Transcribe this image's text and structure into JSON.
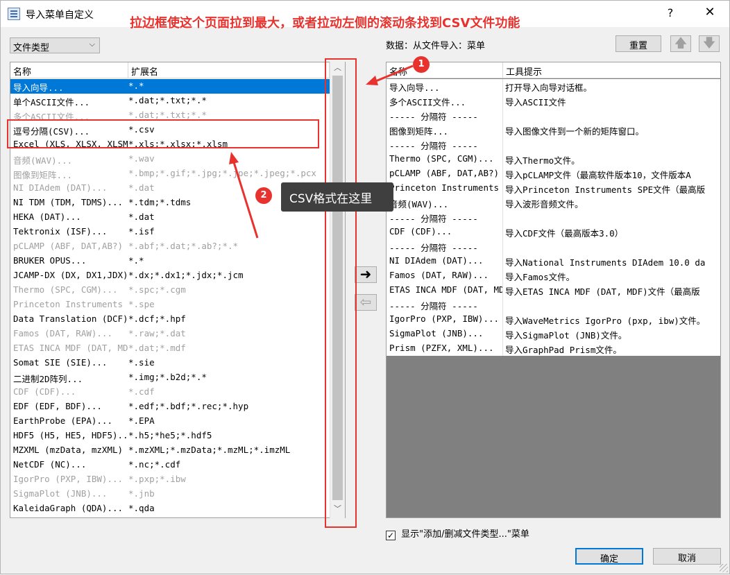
{
  "window": {
    "title": "导入菜单自定义",
    "help": "?",
    "close": "✕"
  },
  "annotation_top": "拉边框使这个页面拉到最大，或者拉动左侧的滚动条找到CSV文件功能",
  "filetype_select": {
    "value": "文件类型",
    "chevron": "⌵"
  },
  "left_list": {
    "headers": [
      "名称",
      "扩展名"
    ],
    "rows": [
      {
        "name": "导入向导...",
        "ext": "*.*",
        "state": "selected"
      },
      {
        "name": "单个ASCII文件...",
        "ext": "*.dat;*.txt;*.*",
        "state": "normal"
      },
      {
        "name": "多个ASCII文件...",
        "ext": "*.dat;*.txt;*.*",
        "state": "disabled"
      },
      {
        "name": "逗号分隔(CSV)...",
        "ext": "*.csv",
        "state": "normal"
      },
      {
        "name": "Excel (XLS, XLSX, XLSM)",
        "ext": "*.xls;*.xlsx;*.xlsm",
        "state": "normal"
      },
      {
        "name": "音频(WAV)...",
        "ext": "*.wav",
        "state": "disabled"
      },
      {
        "name": "图像到矩阵...",
        "ext": "*.bmp;*.gif;*.jpg;*.jpe;*.jpeg;*.pcx",
        "state": "disabled"
      },
      {
        "name": "NI DIAdem (DAT)...",
        "ext": "*.dat",
        "state": "disabled"
      },
      {
        "name": "NI TDM (TDM, TDMS)...",
        "ext": "*.tdm;*.tdms",
        "state": "normal"
      },
      {
        "name": "HEKA (DAT)...",
        "ext": "*.dat",
        "state": "normal"
      },
      {
        "name": "Tektronix (ISF)...",
        "ext": "*.isf",
        "state": "normal"
      },
      {
        "name": "pCLAMP (ABF, DAT,AB?)",
        "ext": "*.abf;*.dat;*.ab?;*.*",
        "state": "disabled"
      },
      {
        "name": "BRUKER OPUS...",
        "ext": "*.*",
        "state": "normal"
      },
      {
        "name": "JCAMP-DX (DX, DX1,JDX)",
        "ext": "*.dx;*.dx1;*.jdx;*.jcm",
        "state": "normal"
      },
      {
        "name": "Thermo (SPC, CGM)...",
        "ext": "*.spc;*.cgm",
        "state": "disabled"
      },
      {
        "name": "Princeton Instruments",
        "ext": "*.spe",
        "state": "disabled"
      },
      {
        "name": "Data Translation (DCF)",
        "ext": "*.dcf;*.hpf",
        "state": "normal"
      },
      {
        "name": "Famos (DAT, RAW)...",
        "ext": "*.raw;*.dat",
        "state": "disabled"
      },
      {
        "name": "ETAS INCA MDF (DAT, MDF)",
        "ext": "*.dat;*.mdf",
        "state": "disabled"
      },
      {
        "name": "Somat SIE (SIE)...",
        "ext": "*.sie",
        "state": "normal"
      },
      {
        "name": "二进制2D阵列...",
        "ext": "*.img;*.b2d;*.*",
        "state": "normal"
      },
      {
        "name": "CDF (CDF)...",
        "ext": "*.cdf",
        "state": "disabled"
      },
      {
        "name": "EDF (EDF, BDF)...",
        "ext": "*.edf;*.bdf;*.rec;*.hyp",
        "state": "normal"
      },
      {
        "name": "EarthProbe (EPA)...",
        "ext": "*.EPA",
        "state": "normal"
      },
      {
        "name": "HDF5 (H5, HE5, HDF5)...",
        "ext": "*.h5;*he5;*.hdf5",
        "state": "normal"
      },
      {
        "name": "MZXML (mzData, mzXML)",
        "ext": "*.mzXML;*.mzData;*.mzML;*.imzML",
        "state": "normal"
      },
      {
        "name": "NetCDF (NC)...",
        "ext": "*.nc;*.cdf",
        "state": "normal"
      },
      {
        "name": "IgorPro (PXP, IBW)...",
        "ext": "*.pxp;*.ibw",
        "state": "disabled"
      },
      {
        "name": "SigmaPlot (JNB)...",
        "ext": "*.jnb",
        "state": "disabled"
      },
      {
        "name": "KaleidaGraph (QDA)...",
        "ext": "*.qda",
        "state": "normal"
      }
    ]
  },
  "scroll": {
    "up": "︿",
    "down": "﹀"
  },
  "move_buttons": {
    "right": "➜",
    "left": "⇦"
  },
  "right_panel": {
    "label": "数据：从文件导入：菜单",
    "reset": "重置",
    "up": "🡅",
    "down": "🡇",
    "headers": [
      "名称",
      "工具提示"
    ],
    "rows": [
      {
        "name": "导入向导...",
        "tip": "打开导入向导对话框。"
      },
      {
        "name": "多个ASCII文件...",
        "tip": "导入ASCII文件"
      },
      {
        "name": "----- 分隔符 -----",
        "tip": ""
      },
      {
        "name": "图像到矩阵...",
        "tip": "导入图像文件到一个新的矩阵窗口。"
      },
      {
        "name": "----- 分隔符 -----",
        "tip": ""
      },
      {
        "name": "Thermo (SPC, CGM)...",
        "tip": "导入Thermo文件。"
      },
      {
        "name": "pCLAMP (ABF, DAT,AB?)",
        "tip": "导入pCLAMP文件（最高软件版本10，文件版本A"
      },
      {
        "name": "Princeton Instruments",
        "tip": "导入Princeton Instruments SPE文件（最高版"
      },
      {
        "name": "音频(WAV)...",
        "tip": "导入波形音频文件。"
      },
      {
        "name": "----- 分隔符 -----",
        "tip": ""
      },
      {
        "name": "CDF (CDF)...",
        "tip": "导入CDF文件（最高版本3.0）"
      },
      {
        "name": "----- 分隔符 -----",
        "tip": ""
      },
      {
        "name": "NI DIAdem (DAT)...",
        "tip": "导入National Instruments DIAdem 10.0 da"
      },
      {
        "name": "Famos (DAT, RAW)...",
        "tip": "导入Famos文件。"
      },
      {
        "name": "ETAS INCA MDF (DAT, MDF)",
        "tip": "导入ETAS INCA MDF (DAT, MDF)文件（最高版"
      },
      {
        "name": "----- 分隔符 -----",
        "tip": ""
      },
      {
        "name": "IgorPro (PXP, IBW)...",
        "tip": "导入WaveMetrics IgorPro (pxp, ibw)文件。"
      },
      {
        "name": "SigmaPlot (JNB)...",
        "tip": "导入SigmaPlot (JNB)文件。"
      },
      {
        "name": "Prism (PZFX, XML)...",
        "tip": "导入GraphPad Prism文件。"
      }
    ]
  },
  "show_menu": {
    "checked": "✓",
    "label": "显示\"添加/删减文件类型...\"菜单"
  },
  "ok": "确定",
  "cancel": "取消",
  "callout1": "1",
  "callout2": "2",
  "csv_tooltip": "CSV格式在这里",
  "colors": {
    "accent": "#0078d7",
    "annotation": "#e8322e"
  }
}
